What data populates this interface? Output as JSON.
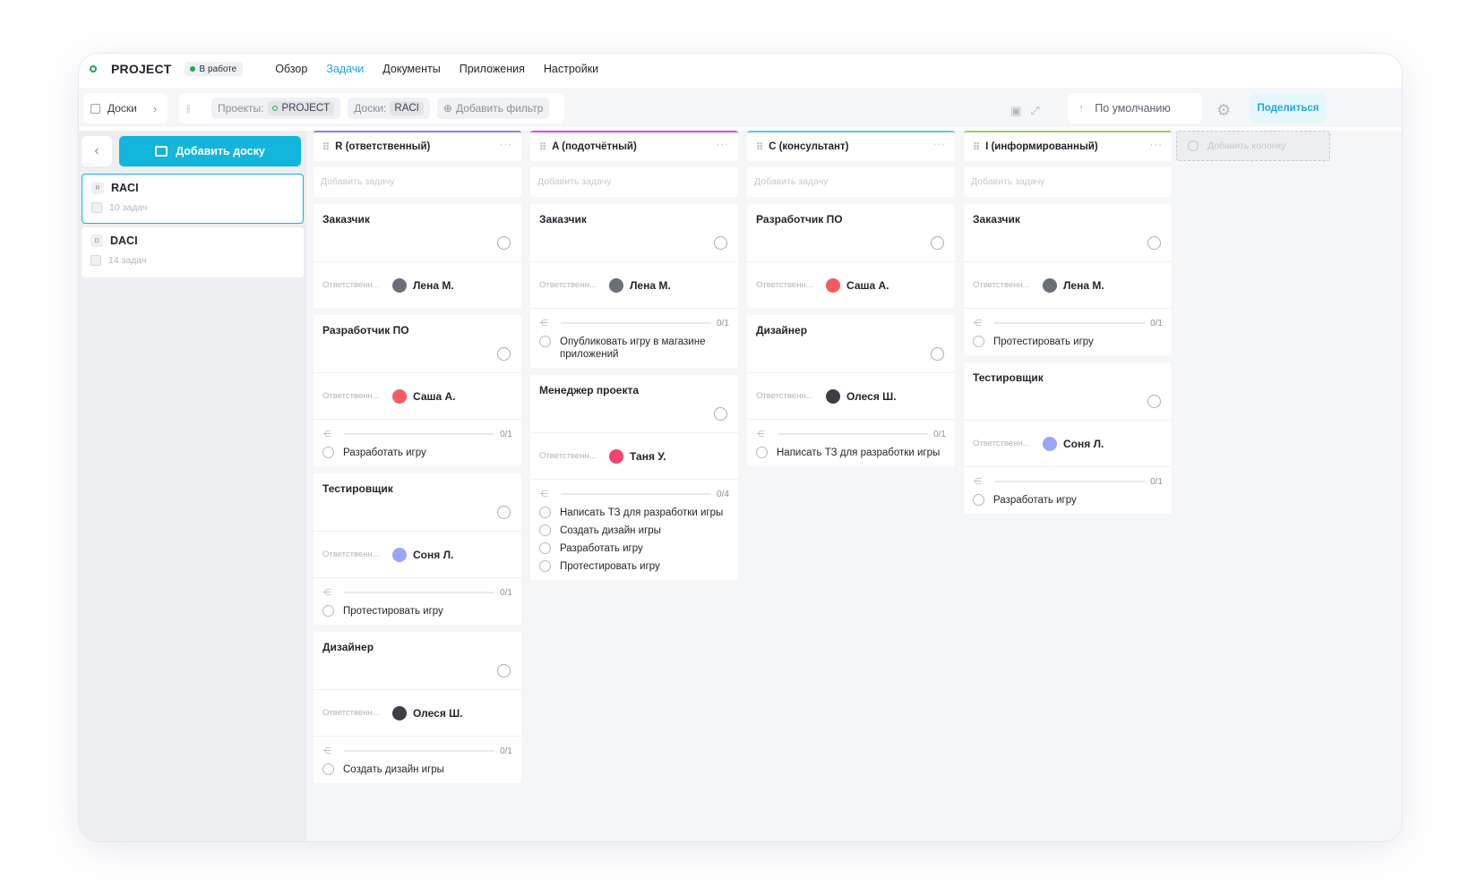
{
  "header": {
    "project_name": "PROJECT",
    "status": "В работе",
    "nav": [
      "Обзор",
      "Задачи",
      "Документы",
      "Приложения",
      "Настройки"
    ],
    "active_nav": 1
  },
  "toolbar": {
    "boards_label": "Доски",
    "projects_label": "Проекты:",
    "projects_value": "PROJECT",
    "boards_filter_label": "Доски:",
    "boards_filter_value": "RACI",
    "add_filter": "Добавить фильтр",
    "sort_label": "По умолчанию",
    "share_label": "Поделиться"
  },
  "sidebar": {
    "add_board_label": "Добавить доску",
    "boards": [
      {
        "letter": "R",
        "name": "RACI",
        "count": "10 задач"
      },
      {
        "letter": "D",
        "name": "DACI",
        "count": "14 задач"
      }
    ]
  },
  "board": {
    "add_task_placeholder": "Добавить задачу",
    "add_column": "Добавить колонку",
    "responsible_label": "Ответственн...",
    "columns": [
      {
        "title": "R (ответственный)",
        "accent": "#8a7cf0",
        "cards": [
          {
            "title": "Заказчик",
            "person": "Лена М.",
            "avatar_color": "#6a6f78",
            "subtasks": null
          },
          {
            "title": "Разработчик ПО",
            "person": "Саша А.",
            "avatar_color": "#f25c62",
            "subtasks": {
              "progress": "0/1",
              "items": [
                "Разработать игру"
              ]
            }
          },
          {
            "title": "Тестировщик",
            "person": "Соня Л.",
            "avatar_color": "#9aa6f7",
            "subtasks": {
              "progress": "0/1",
              "items": [
                "Протестировать игру"
              ]
            }
          },
          {
            "title": "Дизайнер",
            "person": "Олеся Ш.",
            "avatar_color": "#3d3f45",
            "subtasks": {
              "progress": "0/1",
              "items": [
                "Создать дизайн игры"
              ]
            }
          }
        ]
      },
      {
        "title": "A (подотчётный)",
        "accent": "#d946ef",
        "cards": [
          {
            "title": "Заказчик",
            "person": "Лена М.",
            "avatar_color": "#6a6f78",
            "subtasks": {
              "progress": "0/1",
              "items": [
                "Опубликовать игру в магазине приложений"
              ]
            }
          },
          {
            "title": "Менеджер проекта",
            "person": "Таня У.",
            "avatar_color": "#f0456d",
            "subtasks": {
              "progress": "0/4",
              "items": [
                "Написать ТЗ для разработки игры",
                "Создать дизайн игры",
                "Разработать игру",
                "Протестировать игру"
              ]
            }
          }
        ]
      },
      {
        "title": "C (консультант)",
        "accent": "#5cc7f2",
        "cards": [
          {
            "title": "Разработчик ПО",
            "person": "Саша А.",
            "avatar_color": "#f25c62",
            "subtasks": null
          },
          {
            "title": "Дизайнер",
            "person": "Олеся Ш.",
            "avatar_color": "#3d3f45",
            "subtasks": {
              "progress": "0/1",
              "items": [
                "Написать ТЗ для разработки игры"
              ]
            }
          }
        ]
      },
      {
        "title": "I (информированный)",
        "accent": "#8fd65a",
        "cards": [
          {
            "title": "Заказчик",
            "person": "Лена М.",
            "avatar_color": "#6a6f78",
            "subtasks": {
              "progress": "0/1",
              "items": [
                "Протестировать игру"
              ]
            }
          },
          {
            "title": "Тестировщик",
            "person": "Соня Л.",
            "avatar_color": "#9aa6f7",
            "subtasks": {
              "progress": "0/1",
              "items": [
                "Разработать игру"
              ]
            }
          }
        ]
      }
    ]
  }
}
